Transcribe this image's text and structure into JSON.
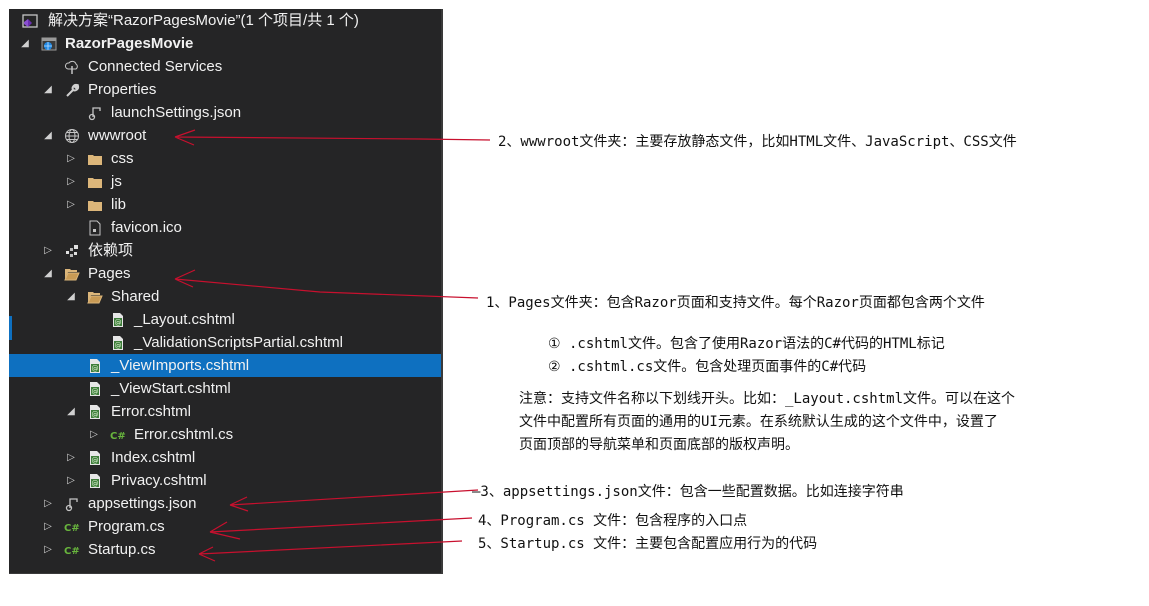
{
  "solution_explorer": {
    "solution_title": "解决方案“RazorPagesMovie”(1 个项目/共 1 个)",
    "selected_item": "_ViewImports.cshtml",
    "colors": {
      "panel_bg": "#252526",
      "selection": "#0e70c0",
      "text": "#f1f1f1",
      "folder": "#dcb67a",
      "csharp": "#68b53d",
      "annotation_arrow": "#c8102e"
    },
    "items": [
      {
        "label": "RazorPagesMovie",
        "icon": "web-project-icon",
        "expander": "expanded"
      },
      {
        "label": "Connected Services",
        "icon": "connected-services-icon",
        "expander": "none"
      },
      {
        "label": "Properties",
        "icon": "wrench-icon",
        "expander": "expanded"
      },
      {
        "label": "launchSettings.json",
        "icon": "json-settings-icon",
        "expander": "none"
      },
      {
        "label": "wwwroot",
        "icon": "globe-icon",
        "expander": "expanded"
      },
      {
        "label": "css",
        "icon": "folder-icon",
        "expander": "collapsed"
      },
      {
        "label": "js",
        "icon": "folder-icon",
        "expander": "collapsed"
      },
      {
        "label": "lib",
        "icon": "folder-icon",
        "expander": "collapsed"
      },
      {
        "label": "favicon.ico",
        "icon": "file-icon",
        "expander": "none"
      },
      {
        "label": "依赖项",
        "icon": "dependencies-icon",
        "expander": "collapsed"
      },
      {
        "label": "Pages",
        "icon": "folder-open-icon",
        "expander": "expanded"
      },
      {
        "label": "Shared",
        "icon": "folder-open-icon",
        "expander": "expanded"
      },
      {
        "label": "_Layout.cshtml",
        "icon": "razor-file-icon",
        "expander": "none"
      },
      {
        "label": "_ValidationScriptsPartial.cshtml",
        "icon": "razor-file-icon",
        "expander": "none"
      },
      {
        "label": "_ViewImports.cshtml",
        "icon": "razor-file-icon",
        "expander": "none"
      },
      {
        "label": "_ViewStart.cshtml",
        "icon": "razor-file-icon",
        "expander": "none"
      },
      {
        "label": "Error.cshtml",
        "icon": "razor-file-icon",
        "expander": "expanded"
      },
      {
        "label": "Error.cshtml.cs",
        "icon": "csharp-icon",
        "expander": "collapsed"
      },
      {
        "label": "Index.cshtml",
        "icon": "razor-file-icon",
        "expander": "collapsed"
      },
      {
        "label": "Privacy.cshtml",
        "icon": "razor-file-icon",
        "expander": "collapsed"
      },
      {
        "label": "appsettings.json",
        "icon": "json-settings-icon",
        "expander": "collapsed"
      },
      {
        "label": "Program.cs",
        "icon": "csharp-icon",
        "expander": "collapsed"
      },
      {
        "label": "Startup.cs",
        "icon": "csharp-icon",
        "expander": "collapsed"
      }
    ]
  },
  "annotations": {
    "wwwroot": "2、wwwroot文件夹：主要存放静态文件，比如HTML文件、JavaScript、CSS文件",
    "pages": "1、Pages文件夹：包含Razor页面和支持文件。每个Razor页面都包含两个文件",
    "cshtml": "① .cshtml文件。包含了使用Razor语法的C#代码的HTML标记",
    "cshtml_cs": "② .cshtml.cs文件。包含处理页面事件的C#代码",
    "note_lines": [
      "注意：支持文件名称以下划线开头。比如：_Layout.cshtml文件。可以在这个",
      "文件中配置所有页面的通用的UI元素。在系统默认生成的这个文件中，设置了",
      "页面顶部的导航菜单和页面底部的版权声明。"
    ],
    "appsettings": "—3、appsettings.json文件：包含一些配置数据。比如连接字符串",
    "program": "4、Program.cs  文件：包含程序的入口点",
    "startup": "5、Startup.cs 文件：主要包含配置应用行为的代码"
  }
}
